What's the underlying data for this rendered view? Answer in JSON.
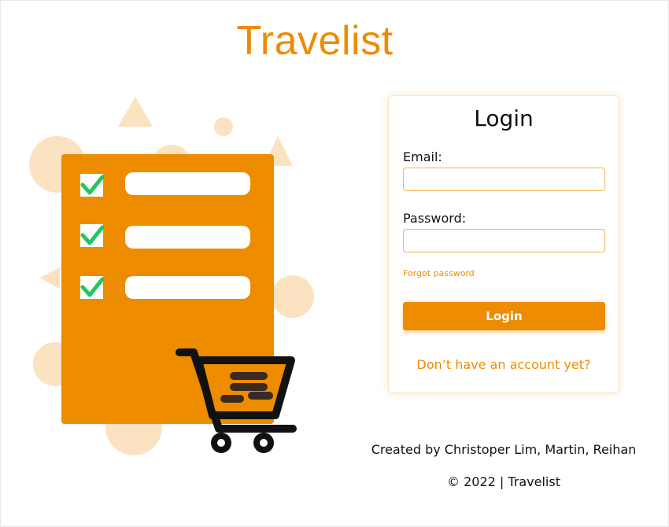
{
  "app": {
    "title": "Travelist"
  },
  "login": {
    "title": "Login",
    "email_label": "Email:",
    "email_value": "",
    "password_label": "Password:",
    "password_value": "",
    "forgot_label": "Forgot password",
    "submit_label": "Login",
    "signup_label": "Don’t have an account yet?"
  },
  "footer": {
    "credit": "Created by Christoper Lim, Martin, Reihan",
    "copyright": "© 2022 | Travelist"
  },
  "colors": {
    "accent": "#ee8c00",
    "accent_light": "#fbe3c2",
    "check": "#22c55e"
  },
  "illustration": {
    "icons": [
      "checklist-icon",
      "check-icon",
      "shopping-cart-icon"
    ]
  }
}
